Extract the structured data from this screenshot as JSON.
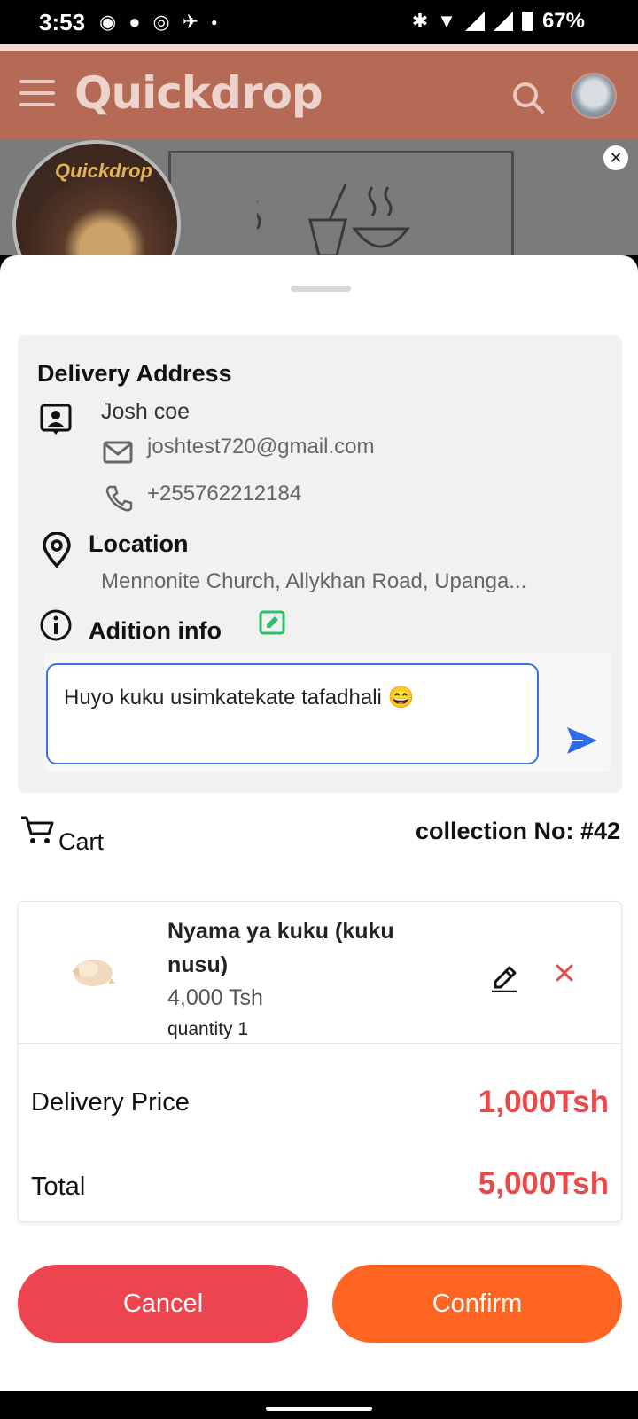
{
  "status_bar": {
    "time": "3:53",
    "battery": "67%",
    "left_icons": [
      "whatsapp-icon",
      "chat-bubble-icon",
      "app-icon",
      "messenger-icon",
      "dot-icon"
    ],
    "right_icons": [
      "bluetooth-icon",
      "wifi-icon",
      "signal-icon",
      "signal-2-icon",
      "battery-icon"
    ]
  },
  "header": {
    "brand": "Quickdrop"
  },
  "banner": {
    "circle_text": "Quickdrop"
  },
  "delivery": {
    "title": "Delivery Address",
    "name": "Josh coe",
    "email": "joshtest720@gmail.com",
    "phone": "+255762212184",
    "location_label": "Location",
    "location_value": "Mennonite Church, Allykhan Road, Upanga...",
    "info_label": "Adition info",
    "note_value": "Huyo kuku usimkatekate tafadhali 😄"
  },
  "cart": {
    "label": "Cart",
    "collection": "collection No: #42",
    "items": [
      {
        "name": "Nyama ya kuku (kuku nusu)",
        "price": "4,000 Tsh",
        "quantity": "quantity 1"
      }
    ],
    "delivery_price_label": "Delivery Price",
    "delivery_price_value": "1,000Tsh",
    "total_label": "Total",
    "total_value": "5,000Tsh"
  },
  "actions": {
    "cancel": "Cancel",
    "confirm": "Confirm"
  },
  "colors": {
    "header_bg": "#b56a56",
    "accent_red": "#e64a4a",
    "cancel_bg": "#ec4550",
    "confirm_bg": "#ff6522",
    "input_border": "#3b71e8"
  }
}
